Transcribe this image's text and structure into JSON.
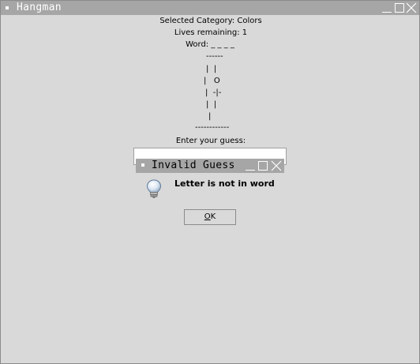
{
  "window": {
    "title": "Hangman"
  },
  "game": {
    "category_line": "Selected Category: Colors",
    "lives_line": "Lives remaining: 1",
    "word_line": "Word: _ _ _ _",
    "gallows": {
      "top": "------",
      "row1": "|  |",
      "row2": "|   O",
      "row3": "|  -|-",
      "row4": "|  |",
      "row5": "|",
      "base": "------------"
    },
    "prompt": "Enter your guess:",
    "guess_value": ""
  },
  "dialog": {
    "title": "Invalid Guess",
    "message": "Letter is not in word",
    "icon": "lightbulb-icon",
    "ok_label": "OK"
  },
  "colors": {
    "titlebar": "#a6a6a6",
    "background": "#d9d9d9"
  }
}
